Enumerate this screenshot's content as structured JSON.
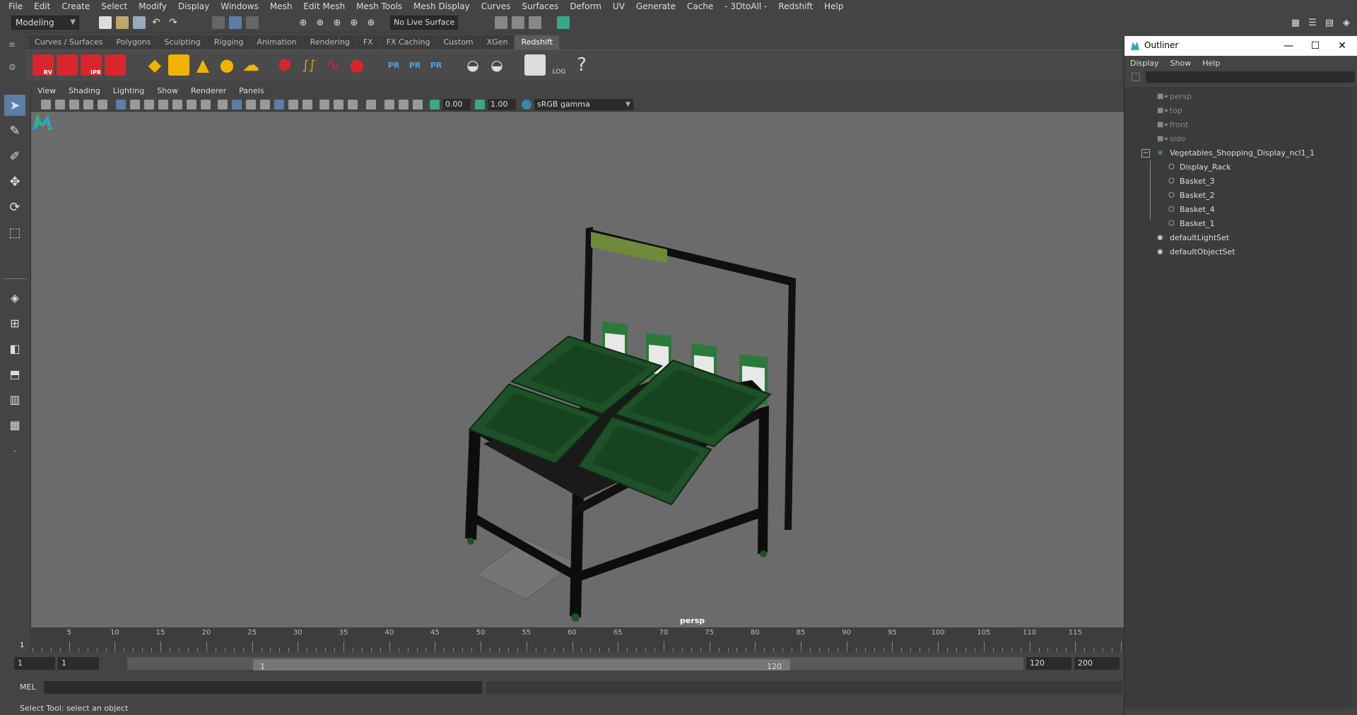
{
  "menubar": {
    "items": [
      "File",
      "Edit",
      "Create",
      "Select",
      "Modify",
      "Display",
      "Windows",
      "Mesh",
      "Edit Mesh",
      "Mesh Tools",
      "Mesh Display",
      "Curves",
      "Surfaces",
      "Deform",
      "UV",
      "Generate",
      "Cache",
      "- 3DtoAll -",
      "Redshift",
      "Help"
    ]
  },
  "statusline": {
    "mode": "Modeling",
    "live_surface": "No Live Surface"
  },
  "shelf": {
    "tabs": [
      "Curves / Surfaces",
      "Polygons",
      "Sculpting",
      "Rigging",
      "Animation",
      "Rendering",
      "FX",
      "FX Caching",
      "Custom",
      "XGen",
      "Redshift"
    ],
    "active_tab": "Redshift",
    "icon_labels": {
      "rv": "RV",
      "ipr": "IPR",
      "pr": "PR",
      "log": "LOG",
      "help": "?"
    }
  },
  "panel": {
    "menu": [
      "View",
      "Shading",
      "Lighting",
      "Show",
      "Renderer",
      "Panels"
    ],
    "exposure": "0.00",
    "gamma": "1.00",
    "color_space": "sRGB gamma"
  },
  "viewport": {
    "camera": "persp"
  },
  "timeslider": {
    "ticks": [
      "5",
      "10",
      "15",
      "20",
      "25",
      "30",
      "35",
      "40",
      "45",
      "50",
      "55",
      "60",
      "65",
      "70",
      "75",
      "80",
      "85",
      "90",
      "95",
      "100",
      "105",
      "110",
      "115"
    ],
    "current_frame": "1"
  },
  "rangeslider": {
    "start_time": "1",
    "playback_start": "1",
    "range_start": "1",
    "range_end": "120",
    "playback_end": "120",
    "end_time": "200"
  },
  "cmdline": {
    "label": "MEL",
    "help": "Select Tool: select an object"
  },
  "outliner": {
    "title": "Outliner",
    "menu": [
      "Display",
      "Show",
      "Help"
    ],
    "items": [
      {
        "label": "persp",
        "kind": "camera"
      },
      {
        "label": "top",
        "kind": "camera"
      },
      {
        "label": "front",
        "kind": "camera"
      },
      {
        "label": "side",
        "kind": "camera"
      },
      {
        "label": "Vegetables_Shopping_Display_ncl1_1",
        "kind": "group"
      },
      {
        "label": "Display_Rack",
        "kind": "mesh"
      },
      {
        "label": "Basket_3",
        "kind": "mesh"
      },
      {
        "label": "Basket_2",
        "kind": "mesh"
      },
      {
        "label": "Basket_4",
        "kind": "mesh"
      },
      {
        "label": "Basket_1",
        "kind": "mesh"
      },
      {
        "label": "defaultLightSet",
        "kind": "set"
      },
      {
        "label": "defaultObjectSet",
        "kind": "set"
      }
    ]
  },
  "colors": {
    "accent": "#5b7ea6",
    "redshift_red": "#d8262c",
    "basket_green": "#1e5128",
    "viewport_bg": "#6b6b6b"
  }
}
